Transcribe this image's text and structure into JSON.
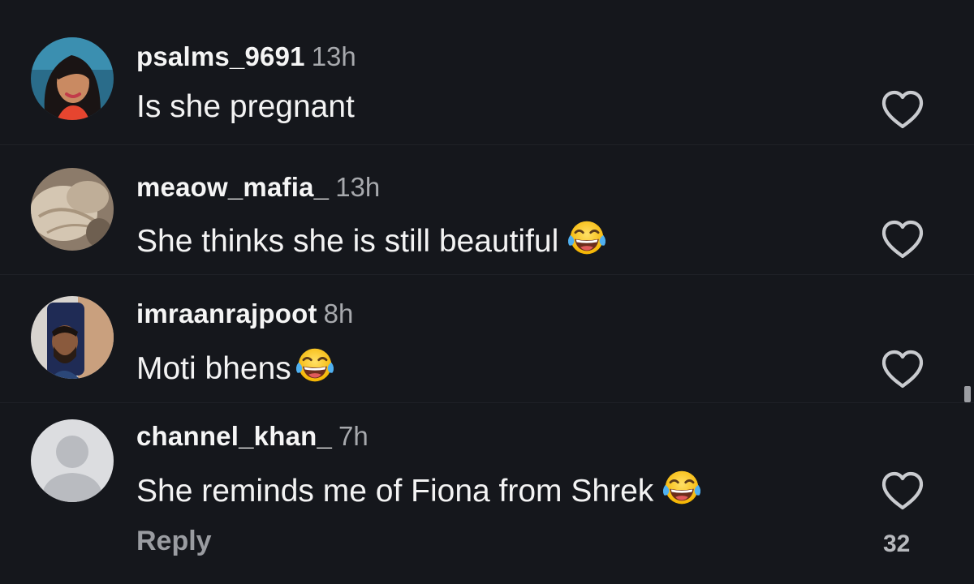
{
  "comments": [
    {
      "username": "psalms_9691",
      "time": "13h",
      "text": "Is she pregnant",
      "emoji": ""
    },
    {
      "username": "meaow_mafia_",
      "time": "13h",
      "text": "She thinks she is still beautiful",
      "emoji": "face-with-tears-of-joy"
    },
    {
      "username": "imraanrajpoot",
      "time": "8h",
      "text": "Moti bhens",
      "emoji": "face-with-tears-of-joy"
    },
    {
      "username": "channel_khan_",
      "time": "7h",
      "text": "She reminds me of Fiona from Shrek",
      "emoji": "face-with-tears-of-joy"
    }
  ],
  "reply_label": "Reply",
  "like_count": "32",
  "icons": {
    "like": "heart-outline-icon",
    "reaction": "face-with-tears-of-joy"
  },
  "colors": {
    "background": "#15171c",
    "text": "#f2f2f2",
    "muted": "#a7a9ad"
  }
}
